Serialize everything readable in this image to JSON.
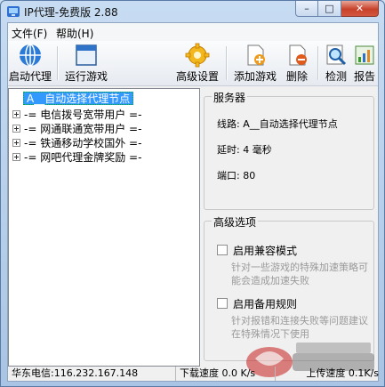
{
  "window": {
    "title": "IP代理-免费版 2.88",
    "close_glyph": "✕",
    "minimize_glyph": "–",
    "maximize_glyph": "□"
  },
  "menu": [
    {
      "label": "文件(F)"
    },
    {
      "label": "帮助(H)"
    }
  ],
  "toolbar": {
    "start_proxy": "启动代理",
    "run_game": "运行游戏",
    "advanced_settings": "高级设置",
    "add_game": "添加游戏",
    "delete": "删除",
    "detect": "检测",
    "report": "报告"
  },
  "tree": {
    "selected": "A__自动选择代理节点",
    "items": [
      {
        "label": "-= 电信拨号宽带用户 =-"
      },
      {
        "label": "-= 网通联通宽带用户 =-"
      },
      {
        "label": "-= 铁通移动学校国外 =-"
      },
      {
        "label": "-= 网吧代理金牌奖励 =-"
      }
    ]
  },
  "server": {
    "title": "服务器",
    "route_label": "线路:",
    "route_value": "A__自动选择代理节点",
    "latency_label": "延时:",
    "latency_value": "4 毫秒",
    "port_label": "端口:",
    "port_value": "80"
  },
  "advanced": {
    "title": "高级选项",
    "compat_label": "启用兼容模式",
    "compat_desc": "针对一些游戏的特殊加速策略可能会造成加速失败",
    "backup_label": "启用备用规则",
    "backup_desc": "针对报错和连接失败等问题建议在特殊情况下使用"
  },
  "status": {
    "isp": "华东电信:116.232.167.148",
    "download": "下载速度 0.0 K/s",
    "upload": "上传速度 0.1K/s"
  },
  "colors": {
    "selection": "#3399ff",
    "close_button": "#c7412a"
  }
}
